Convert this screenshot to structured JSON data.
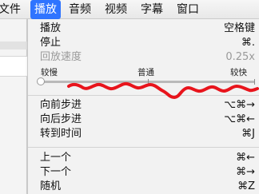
{
  "menubar": {
    "file": "文件",
    "play": "播放",
    "audio": "音频",
    "video": "视频",
    "subtitle": "字幕",
    "window": "窗口"
  },
  "menu": {
    "items": [
      {
        "label": "播放",
        "shortcut": "空格键",
        "enabled": true
      },
      {
        "label": "停止",
        "shortcut": "⌘.",
        "enabled": true
      },
      {
        "label": "回放速度",
        "shortcut": "0.25x",
        "enabled": false
      }
    ],
    "speed": {
      "slow_label": "较慢",
      "normal_label": "普通",
      "fast_label": "较快",
      "level": 0.0
    },
    "step_items": [
      {
        "label": "向前步进",
        "shortcut": "⌥⌘→"
      },
      {
        "label": "向后步进",
        "shortcut": "⌥⌘←"
      },
      {
        "label": "转到时间",
        "shortcut": "⌘J"
      }
    ],
    "track_items": [
      {
        "label": "上一个",
        "shortcut": "⌘←"
      },
      {
        "label": "下一个",
        "shortcut": "⌘→"
      },
      {
        "label": "随机",
        "shortcut": "⌘Z"
      }
    ]
  },
  "colors": {
    "accent": "#2f74ff",
    "annotation": "#e8141c"
  }
}
